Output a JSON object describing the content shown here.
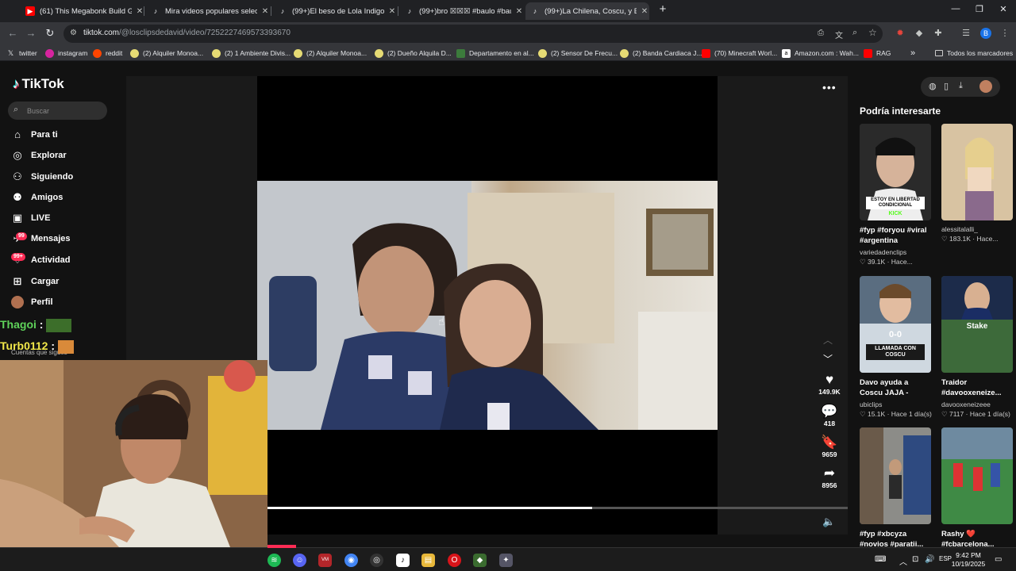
{
  "browser": {
    "tabs": [
      {
        "label": "(61) This Megabonk Build Gives",
        "icon": "youtube-icon"
      },
      {
        "label": "Mira videos populares seleccion",
        "icon": "tiktok-icon"
      },
      {
        "label": "(99+)El beso de Lola Indigo e I",
        "icon": "tiktok-icon"
      },
      {
        "label": "(99+)bro ☒☒☒ #baulo #bau",
        "icon": "tiktok-icon"
      },
      {
        "label": "(99+)La Chilena, Coscu, y Brend",
        "icon": "tiktok-icon",
        "active": true
      }
    ],
    "new_tab": "+",
    "window_controls": {
      "minimize": "—",
      "restore": "❐",
      "close": "✕"
    },
    "url_domain": "tiktok.com",
    "url_path": "/@losclipsdedavid/video/7252227469573393670",
    "bookmarks": [
      "twitter",
      "instagram",
      "reddit",
      "(2) Alquiler Monoa...",
      "(2) 1 Ambiente Divis...",
      "(2) Alquiler Monoa...",
      "(2) Dueño Alquila D...",
      "Departamento en al...",
      "(2) Sensor De Frecu...",
      "(2) Banda Cardiaca J...",
      "(70) Minecraft Worl...",
      "Amazon.com : Wah...",
      "RAG"
    ],
    "bookmarks_overflow": "»",
    "all_bookmarks": "Todos los marcadores"
  },
  "tiktok": {
    "logo": "TikTok",
    "search_placeholder": "Buscar",
    "nav": [
      {
        "label": "Para ti",
        "icon": "home-icon"
      },
      {
        "label": "Explorar",
        "icon": "compass-icon"
      },
      {
        "label": "Siguiendo",
        "icon": "following-icon"
      },
      {
        "label": "Amigos",
        "icon": "friends-icon"
      },
      {
        "label": "LIVE",
        "icon": "live-icon"
      },
      {
        "label": "Mensajes",
        "icon": "messages-icon",
        "badge": "99"
      },
      {
        "label": "Actividad",
        "icon": "activity-icon",
        "badge": "99+"
      },
      {
        "label": "Cargar",
        "icon": "upload-icon"
      },
      {
        "label": "Perfil",
        "icon": "avatar"
      }
    ],
    "following_accounts_label": "Cuentas que sigues",
    "video": {
      "likes": "149.9K",
      "comments": "418",
      "saves": "9659",
      "shares": "8956",
      "progress": 0.56
    },
    "recommend_title": "Podría interesarte",
    "recommendations": [
      {
        "title": "#fyp #foryou #viral #argentina",
        "user": "variedadenclips",
        "views": "39.1K",
        "time": "Hace...",
        "overlay": "ESTOY EN LIBERTAD CONDICIONAL",
        "overlay2": "KICK"
      },
      {
        "title": "",
        "user": "alessitalalli_",
        "views": "183.1K",
        "time": "Hace..."
      },
      {
        "title": "Davo ayuda a Coscu JAJA - #coscu...",
        "user": "ubiclips",
        "views": "15.1K",
        "time": "Hace 1 día(s)",
        "overlay": "0-0",
        "overlay2": "LLAMADA CON COSCU"
      },
      {
        "title": "Traidor #davooxeneize...",
        "user": "davooxeneizeee",
        "views": "7117",
        "time": "Hace 1 día(s)",
        "overlay": "Stake"
      },
      {
        "title": "#fyp #xbcyza #novios #paratii...",
        "user": "",
        "views": "",
        "time": ""
      },
      {
        "title": "Rashy ❤️ #fcbarcelona...",
        "user": "",
        "views": "",
        "time": ""
      }
    ]
  },
  "stream_overlay": {
    "chat": [
      {
        "user": "Thagoi",
        "sep": " :",
        "color": "#5fd35a"
      },
      {
        "user": "Turb0112",
        "sep": " :",
        "color": "#f2e84a"
      }
    ]
  },
  "taskbar": {
    "time": "9:42 PM",
    "date": "10/19/2025",
    "lang": "ESP"
  }
}
